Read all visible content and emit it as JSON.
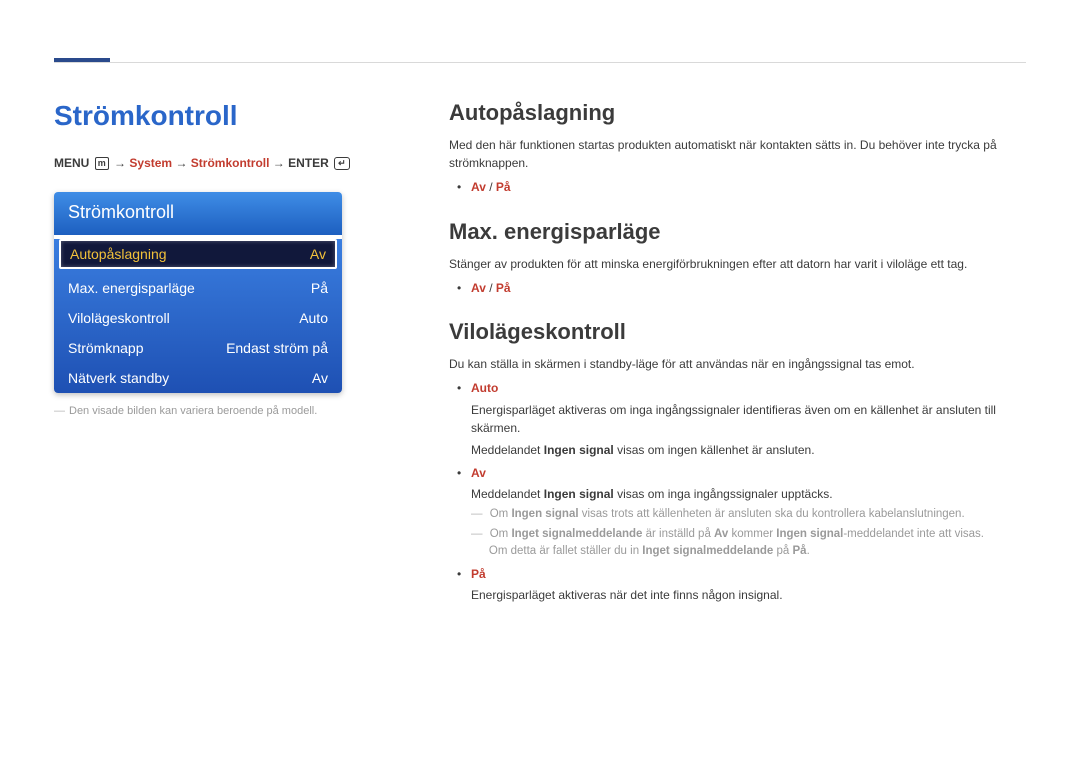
{
  "main_title": "Strömkontroll",
  "breadcrumb": {
    "menu": "MENU",
    "arrow": "→",
    "system": "System",
    "stromkontroll": "Strömkontroll",
    "enter": "ENTER"
  },
  "menu": {
    "header": "Strömkontroll",
    "rows": [
      {
        "label": "Autopåslagning",
        "value": "Av",
        "selected": true
      },
      {
        "label": "Max. energisparläge",
        "value": "På",
        "selected": false
      },
      {
        "label": "Vilolägeskontroll",
        "value": "Auto",
        "selected": false
      },
      {
        "label": "Strömknapp",
        "value": "Endast ström på",
        "selected": false
      },
      {
        "label": "Nätverk standby",
        "value": "Av",
        "selected": false
      }
    ]
  },
  "caption": "Den visade bilden kan variera beroende på modell.",
  "sections": {
    "auto": {
      "title": "Autopåslagning",
      "desc": "Med den här funktionen startas produkten automatiskt när kontakten sätts in. Du behöver inte trycka på strömknappen.",
      "opts": {
        "av": "Av",
        "sep": " / ",
        "pa": "På"
      }
    },
    "max": {
      "title": "Max. energisparläge",
      "desc": "Stänger av produkten för att minska energiförbrukningen efter att datorn har varit i viloläge ett tag.",
      "opts": {
        "av": "Av",
        "sep": " / ",
        "pa": "På"
      }
    },
    "vilo": {
      "title": "Vilolägeskontroll",
      "desc": "Du kan ställa in skärmen i standby-läge för att användas när en ingångssignal tas emot.",
      "auto_label": "Auto",
      "auto_line1a": "Energisparläget aktiveras om inga ingångssignaler identifieras även om en källenhet är ansluten till skärmen.",
      "auto_line2_pre": "Meddelandet ",
      "ingen_signal": "Ingen signal",
      "auto_line2_post": " visas om ingen källenhet är ansluten.",
      "av_label": "Av",
      "av_line_pre": "Meddelandet ",
      "av_line_post": " visas om inga ingångssignaler upptäcks.",
      "note1_pre": "Om ",
      "note1_post": " visas trots att källenheten är ansluten ska du kontrollera kabelanslutningen.",
      "note2_pre": "Om ",
      "inget_signalmeddelande": "Inget signalmeddelande",
      "note2_mid1": " är inställd på ",
      "av_bold": "Av",
      "note2_mid2": " kommer ",
      "note2_post": "-meddelandet inte att visas.",
      "note2b_pre": "Om detta är fallet ställer du in ",
      "note2b_mid": " på ",
      "pa_bold": "På",
      "note2b_post": ".",
      "pa_label": "På",
      "pa_line": "Energisparläget aktiveras när det inte finns någon insignal."
    }
  }
}
